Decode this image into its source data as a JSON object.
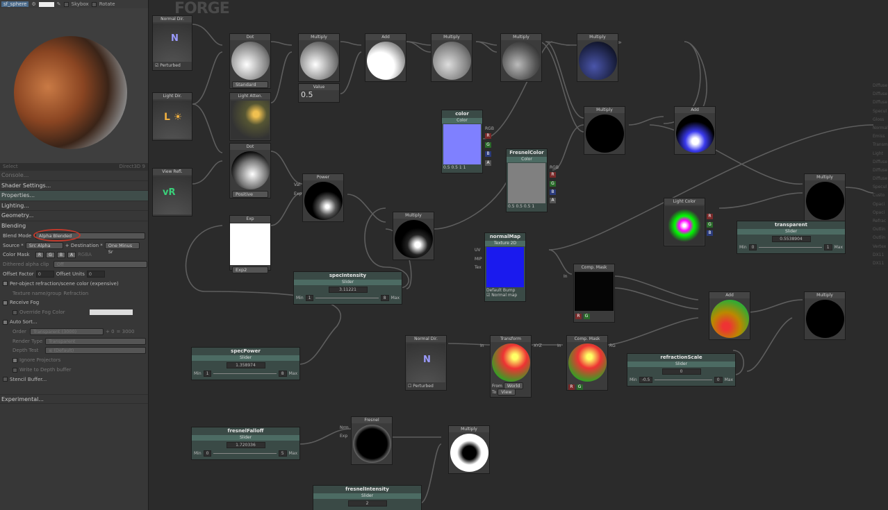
{
  "toolbar": {
    "mesh": "sf_sphere",
    "skybox": "Skybox",
    "rotate": "Rotate"
  },
  "preview_status": {
    "select": "Select",
    "renderer": "Direct3D 9"
  },
  "sections": {
    "console": "Console...",
    "shader_settings": "Shader Settings...",
    "properties": "Properties...",
    "lighting": "Lighting...",
    "geometry": "Geometry...",
    "blending": "Blending",
    "experimental": "Experimental..."
  },
  "blending": {
    "blend_mode_label": "Blend Mode",
    "blend_mode": "Alpha Blended",
    "source_label": "Source *",
    "source": "Src Alpha",
    "dest_label": "+ Destination *",
    "dest": "One Minus Sr",
    "color_mask_label": "Color Mask",
    "mask_r": "R",
    "mask_g": "G",
    "mask_b": "B",
    "mask_a": "A",
    "mask_value": "RGBA",
    "dither_label": "Dithered alpha clip",
    "dither": "Off",
    "offset_factor_label": "Offset Factor",
    "offset_factor": "0",
    "offset_units_label": "Offset Units",
    "offset_units": "0",
    "per_object": "Per-object refraction/scene color (expensive)",
    "texture_name_label": "Texture name/group",
    "texture_name": "Refraction",
    "receive_fog": "Receive Fog",
    "override_fog": "Override Fog Color",
    "auto_sort": "Auto Sort...",
    "order_label": "Order",
    "order": "Transparent (3000)",
    "order_plus": "+ 0",
    "order_eq": "= 3000",
    "render_type_label": "Render Type",
    "render_type": "Transparent",
    "depth_test_label": "Depth Test",
    "depth_test": "≤ (Default)",
    "ignore_projectors": "Ignore Projectors",
    "write_depth": "Write to Depth buffer",
    "stencil": "Stencil Buffer..."
  },
  "graph": {
    "logo": "FORGE",
    "nodes": {
      "normal_dir": "Normal Dir.",
      "perturbed": "Perturbed",
      "light_dir": "Light Dir.",
      "view_refl": "View Refl.",
      "dot1": "Dot",
      "standard": "Standard",
      "light_atten": "Light Atten.",
      "dot2": "Dot",
      "positive": "Positive",
      "exp": "Exp",
      "exp2": "Exp2",
      "mult1": "Multiply",
      "value": "Value",
      "value_num": "0.5",
      "add1": "Add",
      "mult2": "Multiply",
      "mult3": "Multiply",
      "mult4": "Multiply",
      "power": "Power",
      "val": "Val",
      "exp_pin": "Exp",
      "mult5": "Multiply",
      "color": "color",
      "color_sub": "Color",
      "color_vals": "0.5  0.5  1     1",
      "fresnel_color": "FresnelColor",
      "fresnel_color_sub": "Color",
      "fresnel_vals": "0.5  0.5  0.5  1",
      "normal_map": "normalMap",
      "normal_map_sub": "Texture 2D",
      "default": "Default",
      "bump": "Bump",
      "normal_map_cb": "Normal map",
      "mult6": "Multiply",
      "add2": "Add",
      "light_color": "Light Color",
      "mult7": "Multiply",
      "comp_mask1": "Comp. Mask",
      "add3": "Add",
      "mult8": "Multiply",
      "normal_dir2": "Normal Dir.",
      "perturbed2": "Perturbed",
      "transform": "Transform",
      "from": "From",
      "world": "World",
      "to": "To",
      "view": "View",
      "comp_mask2": "Comp. Mask",
      "fresnel": "Fresnel",
      "nrm": "Nrm",
      "exp3": "Exp",
      "mult9": "Multiply",
      "rgb": "RGB",
      "in": "In",
      "xyz": "XYZ",
      "rg": "RG",
      "uv": "UV",
      "mip": "MIP",
      "tex": "Tex"
    },
    "sliders": {
      "spec_intensity": {
        "title": "specIntensity",
        "sub": "Slider",
        "value": "3.11221",
        "min_label": "Min",
        "min": "1",
        "max": "8",
        "max_label": "Max"
      },
      "spec_power": {
        "title": "specPower",
        "sub": "Slider",
        "value": "1.358974",
        "min_label": "Min",
        "min": "1",
        "max": "8",
        "max_label": "Max"
      },
      "fresnel_falloff": {
        "title": "fresnelFalloff",
        "sub": "Slider",
        "value": "1.720336",
        "min_label": "Min",
        "min": "0",
        "max": "5",
        "max_label": "Max"
      },
      "fresnel_intensity": {
        "title": "fresnelIntensity",
        "sub": "Slider",
        "value": "2"
      },
      "transparent": {
        "title": "transparent",
        "sub": "Slider",
        "value": "0.5538904",
        "min_label": "Min",
        "min": "0",
        "max": "1",
        "max_label": "Max"
      },
      "refraction_scale": {
        "title": "refractionScale",
        "sub": "Slider",
        "value": "0",
        "min_label": "Min",
        "min": "-0.5",
        "max": "0",
        "max_label": "Max"
      }
    }
  },
  "main_props": [
    "Diffuse",
    "Diffuse",
    "Diffuse",
    "Specul",
    "Gloss",
    "Normal",
    "Emiss",
    "Transm",
    "Light",
    "Diffuse",
    "Diffuse",
    "Diffuse",
    "Specul",
    "Custo",
    "Opaci",
    "Opaci",
    "Refrac",
    "Outlin",
    "Outlin",
    "Vertex",
    "DX11",
    "DX11"
  ],
  "colors": {
    "accent": "#3f4d4a",
    "ring": "#c0392b"
  }
}
